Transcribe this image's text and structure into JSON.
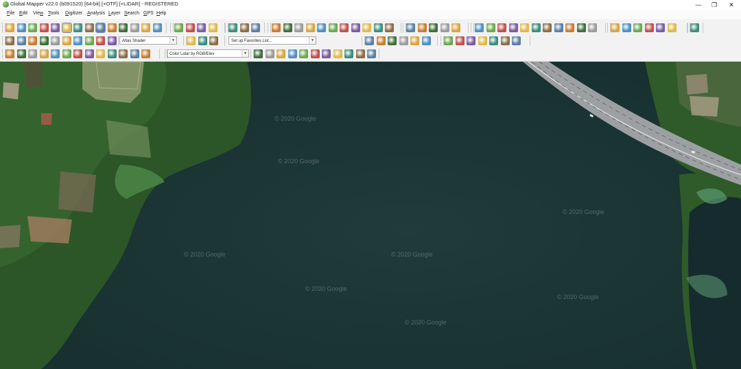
{
  "window": {
    "title": "Global Mapper v22.0 (b091520) [64-bit] [+OTF] [+LIDAR] - REGISTERED",
    "controls": {
      "minimize": "—",
      "maximize": "❐",
      "close": "✕"
    }
  },
  "menubar": {
    "items": [
      {
        "label": "File",
        "accel": "F",
        "rest": "ile"
      },
      {
        "label": "Edit",
        "accel": "E",
        "rest": "dit"
      },
      {
        "label": "View",
        "accel": "",
        "rest": "Vie",
        "accel2": "w"
      },
      {
        "label": "Tools",
        "accel": "T",
        "rest": "ools"
      },
      {
        "label": "Digitizer",
        "accel": "D",
        "rest": "igitizer"
      },
      {
        "label": "Analysis",
        "accel": "A",
        "rest": "nalysis"
      },
      {
        "label": "Layer",
        "accel": "L",
        "rest": "ayer"
      },
      {
        "label": "Search",
        "accel": "S",
        "rest": "earch"
      },
      {
        "label": "GPS",
        "accel": "G",
        "rest": "PS"
      },
      {
        "label": "Help",
        "accel": "H",
        "rest": "elp"
      }
    ]
  },
  "toolbar": {
    "shader_select": "Atlas Shader",
    "favorites_select": "Set up Favorites List...",
    "lidar_color_select": "Color Lidar by RGB/Elev"
  },
  "colors": {
    "water": "#1c3434",
    "vegetation": "#2f5a2a",
    "road": "#9ca0a3",
    "toolbar_bg": "#f2f2f2"
  },
  "map": {
    "watermarks": [
      "© 2020 Google",
      "© 2020 Google",
      "© 2020 Google",
      "© 2020 Google",
      "© 2020 Google",
      "© 2020 Google",
      "© 2020 Google",
      "© 2020 Google"
    ]
  }
}
